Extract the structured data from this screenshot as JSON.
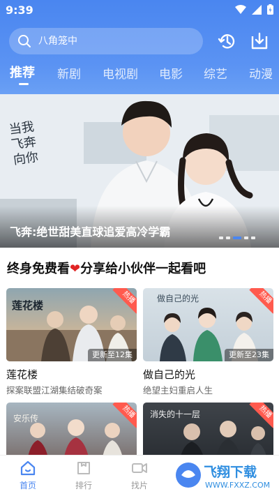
{
  "status": {
    "time": "9:39"
  },
  "search": {
    "placeholder": "八角笼中"
  },
  "tabs": [
    {
      "label": "推荐"
    },
    {
      "label": "新剧"
    },
    {
      "label": "电视剧"
    },
    {
      "label": "电影"
    },
    {
      "label": "综艺"
    },
    {
      "label": "动漫"
    }
  ],
  "banner": {
    "caption": "飞奔:绝世甜美直球追爱高冷学霸",
    "calligraphy": "当我飞奔向你",
    "slide_count": 5,
    "active_slide": 3
  },
  "section": {
    "title_part1": "终身免费看",
    "heart": "❤",
    "title_part2": "分享给小伙伴一起看吧"
  },
  "cards": [
    {
      "title": "莲花楼",
      "desc": "探案联盟江湖集结破奇案",
      "badge": "更新至12集",
      "hot": "热播",
      "thumb_text": "莲花楼"
    },
    {
      "title": "做自己的光",
      "desc": "绝望主妇重启人生",
      "badge": "更新至23集",
      "hot": "热播",
      "thumb_text": "做自己的光"
    },
    {
      "title": "",
      "desc": "",
      "badge": "",
      "hot": "热播",
      "thumb_text": "安乐传"
    },
    {
      "title": "",
      "desc": "",
      "badge": "",
      "hot": "热播",
      "thumb_text": "消失的十一层"
    }
  ],
  "nav": [
    {
      "label": "首页",
      "icon": "home-icon"
    },
    {
      "label": "排行",
      "icon": "ranking-icon"
    },
    {
      "label": "找片",
      "icon": "video-icon"
    },
    {
      "label": "",
      "icon": ""
    },
    {
      "label": "",
      "icon": ""
    }
  ],
  "watermark": {
    "text": "飞翔下载",
    "url": "WWW.FXXZ.COM"
  },
  "colors": {
    "accent": "#4a86f0",
    "hot": "#ff5a4e",
    "heart": "#e02424"
  }
}
